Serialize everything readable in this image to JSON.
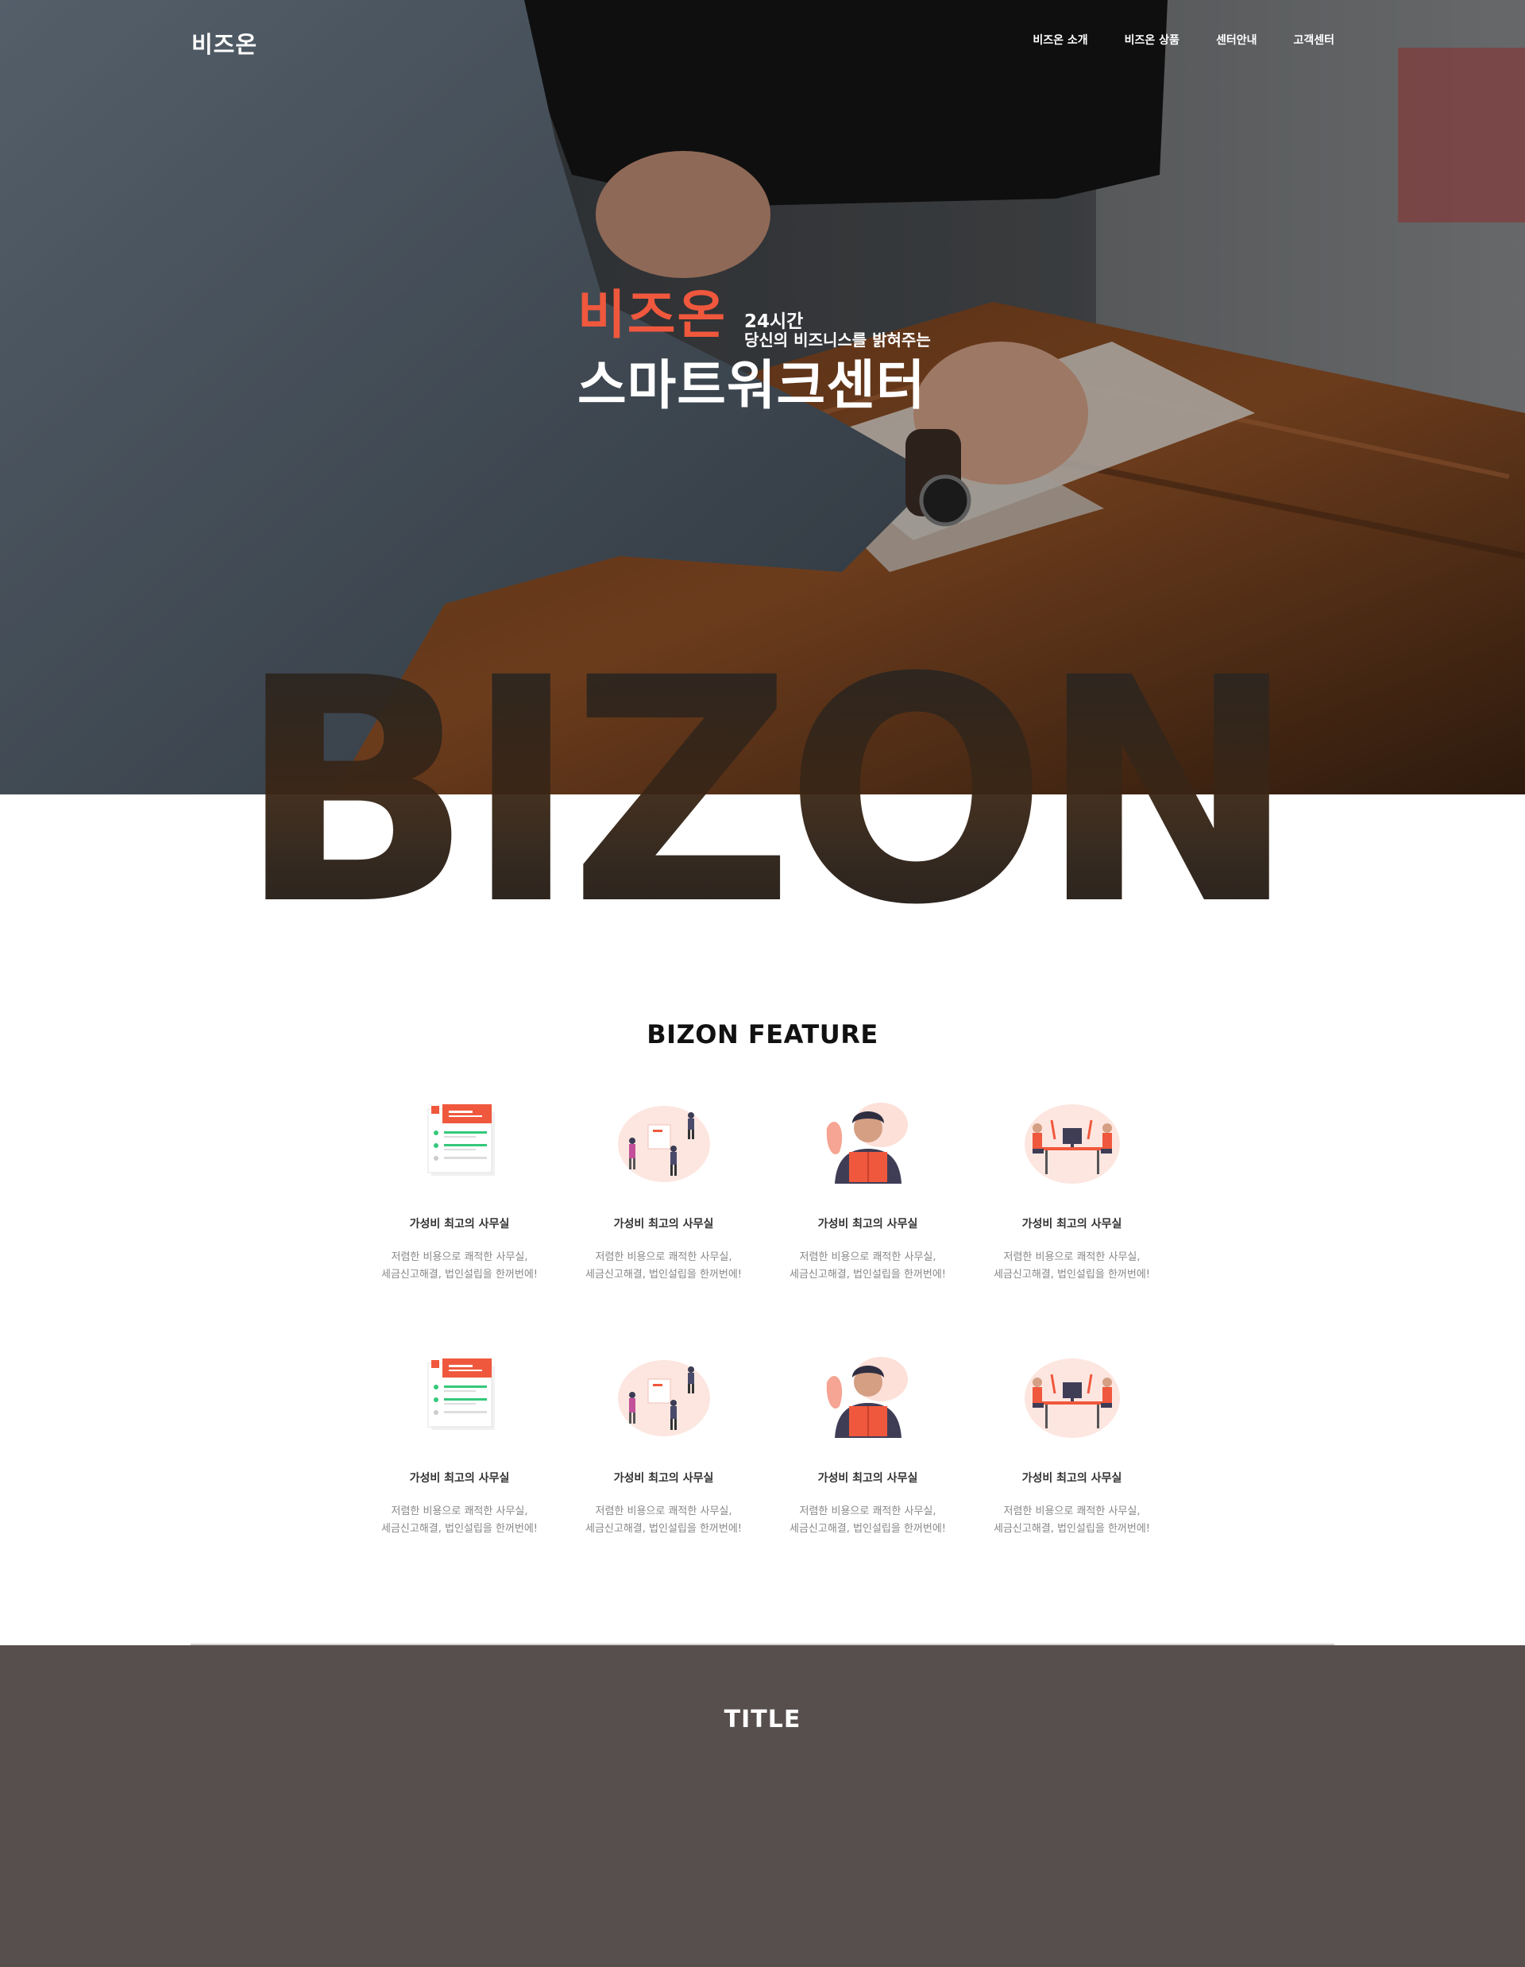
{
  "header": {
    "logo": "비즈온",
    "menu": [
      "비즈온 소개",
      "비즈온 상품",
      "센터안내",
      "고객센터"
    ]
  },
  "hero": {
    "brand": "비즈온",
    "tagline_1": "24시간",
    "tagline_2": "당신의 비즈니스를 밝혀주는",
    "headline": "스마트워크센터",
    "big_word": "BIZON"
  },
  "feature": {
    "title": "BIZON FEATURE",
    "items": [
      {
        "icon": "office-list-illustration",
        "title": "가성비 최고의 사무실",
        "desc1": "저렴한 비용으로 쾌적한 사무실,",
        "desc2": "세금신고해결, 법인설립을 한꺼번에!"
      },
      {
        "icon": "team-presentation-illustration",
        "title": "가성비 최고의 사무실",
        "desc1": "저렴한 비용으로 쾌적한 사무실,",
        "desc2": "세금신고해결, 법인설립을 한꺼번에!"
      },
      {
        "icon": "man-reading-illustration",
        "title": "가성비 최고의 사무실",
        "desc1": "저렴한 비용으로 쾌적한 사무실,",
        "desc2": "세금신고해결, 법인설립을 한꺼번에!"
      },
      {
        "icon": "desk-workers-illustration",
        "title": "가성비 최고의 사무실",
        "desc1": "저렴한 비용으로 쾌적한 사무실,",
        "desc2": "세금신고해결, 법인설립을 한꺼번에!"
      },
      {
        "icon": "office-list-illustration",
        "title": "가성비 최고의 사무실",
        "desc1": "저렴한 비용으로 쾌적한 사무실,",
        "desc2": "세금신고해결, 법인설립을 한꺼번에!"
      },
      {
        "icon": "team-presentation-illustration",
        "title": "가성비 최고의 사무실",
        "desc1": "저렴한 비용으로 쾌적한 사무실,",
        "desc2": "세금신고해결, 법인설립을 한꺼번에!"
      },
      {
        "icon": "man-reading-illustration",
        "title": "가성비 최고의 사무실",
        "desc1": "저렴한 비용으로 쾌적한 사무실,",
        "desc2": "세금신고해결, 법인설립을 한꺼번에!"
      },
      {
        "icon": "desk-workers-illustration",
        "title": "가성비 최고의 사무실",
        "desc1": "저렴한 비용으로 쾌적한 사무실,",
        "desc2": "세금신고해결, 법인설립을 한꺼번에!"
      }
    ]
  },
  "section2": {
    "title": "TITLE"
  },
  "colors": {
    "accent": "#f0583d",
    "dark_section": "#564f4d",
    "text_dark": "#111111",
    "text_muted": "#888888"
  }
}
